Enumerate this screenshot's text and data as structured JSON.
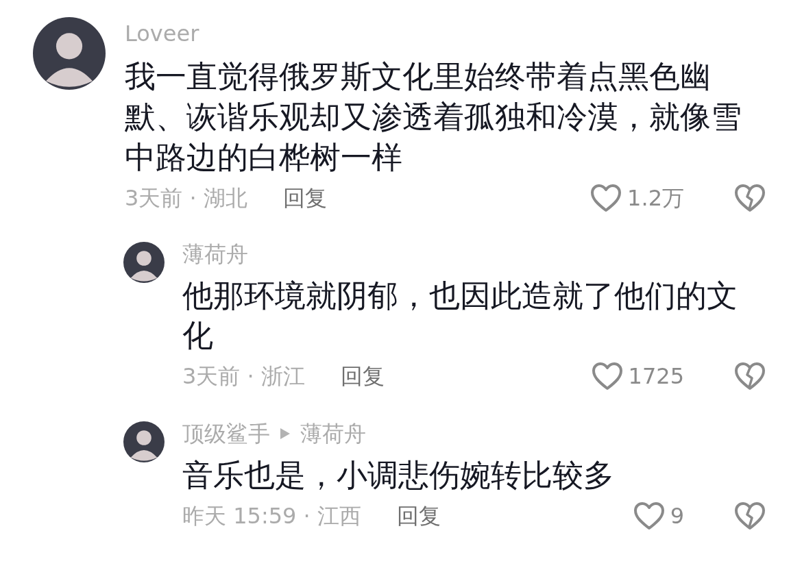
{
  "comments": [
    {
      "user": "Loveer",
      "text": "我一直觉得俄罗斯文化里始终带着点黑色幽默、诙谐乐观却又渗透着孤独和冷漠，就像雪中路边的白桦树一样",
      "meta": "3天前 · 湖北",
      "reply_label": "回复",
      "likes": "1.2万",
      "liked": false,
      "disliked": false,
      "replies": [
        {
          "user": "薄荷舟",
          "text": "他那环境就阴郁，也因此造就了他们的文化",
          "meta": "3天前 · 浙江",
          "reply_label": "回复",
          "likes": "1725",
          "liked": false,
          "disliked": false
        },
        {
          "user": "顶级鲨手",
          "reply_to": "薄荷舟",
          "text": "音乐也是，小调悲伤婉转比较多",
          "meta": "昨天 15:59 · 江西",
          "reply_label": "回复",
          "likes": "9",
          "liked": false,
          "disliked": false
        }
      ]
    }
  ]
}
